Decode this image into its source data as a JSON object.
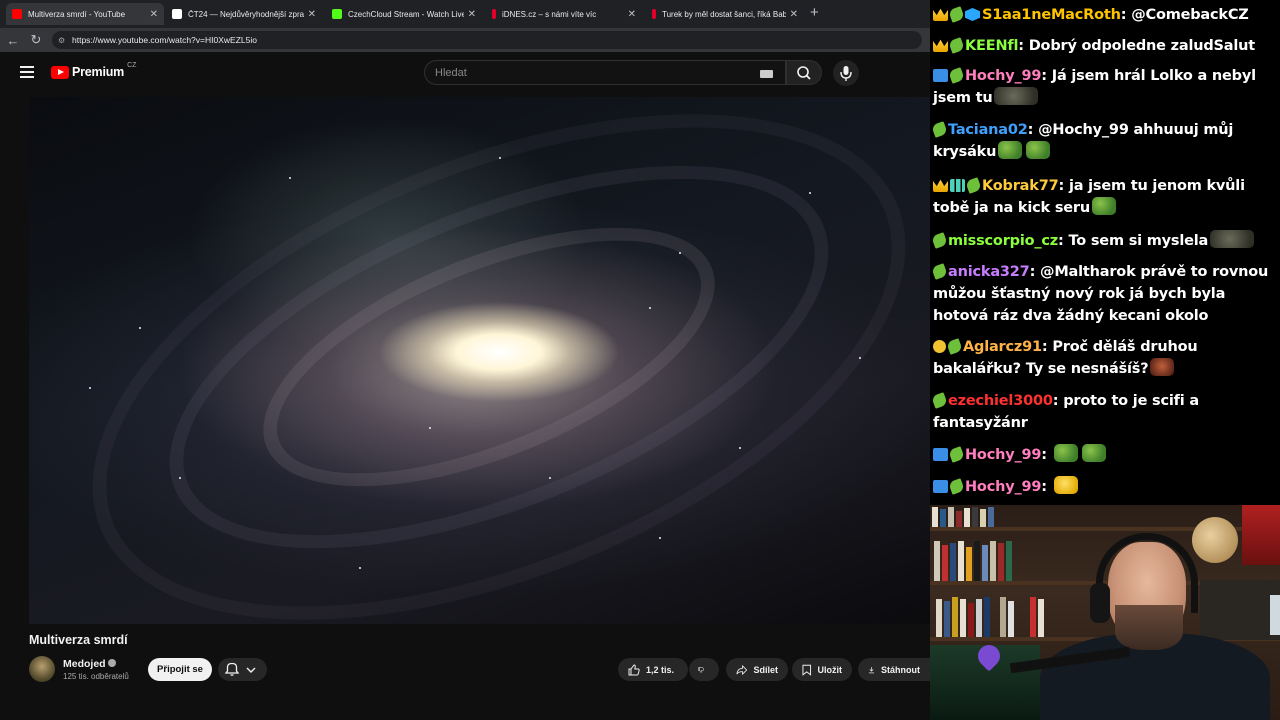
{
  "browser": {
    "tabs": [
      {
        "title": "Multiverza smrdí - YouTube",
        "favicon_color": "#ff0000",
        "active": true
      },
      {
        "title": "ČT24 — Nejdůvěryhodnější zpravo",
        "favicon_color": "#ffffff",
        "active": false
      },
      {
        "title": "CzechCloud Stream - Watch Live o",
        "favicon_color": "#53fc18",
        "active": false
      },
      {
        "title": "iDNES.cz – s námi víte víc",
        "favicon_color": "#e4002b",
        "active": false
      },
      {
        "title": "Turek by měl dostat šanci, říká Bab",
        "favicon_color": "#e4002b",
        "active": false
      }
    ],
    "url": "https://www.youtube.com/watch?v=HI0XwEZL5io"
  },
  "youtube": {
    "logo_text": "Premium",
    "logo_country": "CZ",
    "search_placeholder": "Hledat",
    "video_title": "Multiverza smrdí",
    "channel_name": "Medojed",
    "subscribers": "125 tis. odběratelů",
    "join_label": "Připojit se",
    "likes": "1,2 tis.",
    "share_label": "Sdílet",
    "save_label": "Uložit",
    "download_label": "Stáhnout"
  },
  "chat": {
    "messages": [
      {
        "badges": [
          "crown",
          "leaf",
          "cube"
        ],
        "user": "S1aa1neMacRoth",
        "user_color": "#ffc400",
        "text": "@ComebackCZ",
        "emotes": []
      },
      {
        "badges": [
          "crown",
          "leaf"
        ],
        "user": "KEENfl",
        "user_color": "#8aff3c",
        "text": "Dobrý odpoledne zaludSalut",
        "emotes": []
      },
      {
        "badges": [
          "arrow",
          "leaf"
        ],
        "user": "Hochy_99",
        "user_color": "#ff7fbf",
        "text": "Já jsem hrál Lolko a nebyl jsem tu",
        "emotes": [
          "rat"
        ]
      },
      {
        "badges": [
          "leaf"
        ],
        "user": "Taciana02",
        "user_color": "#3fa0ff",
        "text": "@Hochy_99 ahhuuuj můj krysáku",
        "emotes": [
          "frog",
          "frog"
        ]
      },
      {
        "badges": [
          "crown",
          "bars",
          "leaf"
        ],
        "user": "Kobrak77",
        "user_color": "#ffcb3c",
        "text": "ja jsem tu jenom kvůli tobě ja na kick seru",
        "emotes": [
          "frog"
        ]
      },
      {
        "badges": [
          "leaf"
        ],
        "user": "misscorpio_cz",
        "user_color": "#8aff3c",
        "text": "To sem si myslela",
        "emotes": [
          "rat"
        ]
      },
      {
        "badges": [
          "leaf"
        ],
        "user": "anicka327",
        "user_color": "#c77dff",
        "text": "@Maltharok právě to rovnou můžou šťastný nový rok já bych byla hotová ráz dva žádný kecani okolo",
        "emotes": []
      },
      {
        "badges": [
          "coin",
          "leaf"
        ],
        "user": "Aglarcz91",
        "user_color": "#ffb347",
        "text": "Proč děláš druhou bakalářku? Ty se nesnášíš?",
        "emotes": [
          "face"
        ]
      },
      {
        "badges": [
          "leaf"
        ],
        "user": "ezechiel3000",
        "user_color": "#ff3030",
        "text": "proto to je scifi a fantasyžánr",
        "emotes": []
      },
      {
        "badges": [
          "arrow",
          "leaf"
        ],
        "user": "Hochy_99",
        "user_color": "#ff7fbf",
        "text": "",
        "emotes": [
          "frog",
          "frog"
        ]
      },
      {
        "badges": [
          "arrow",
          "leaf"
        ],
        "user": "Hochy_99",
        "user_color": "#ff7fbf",
        "text": "",
        "emotes": [
          "duck"
        ]
      }
    ]
  }
}
